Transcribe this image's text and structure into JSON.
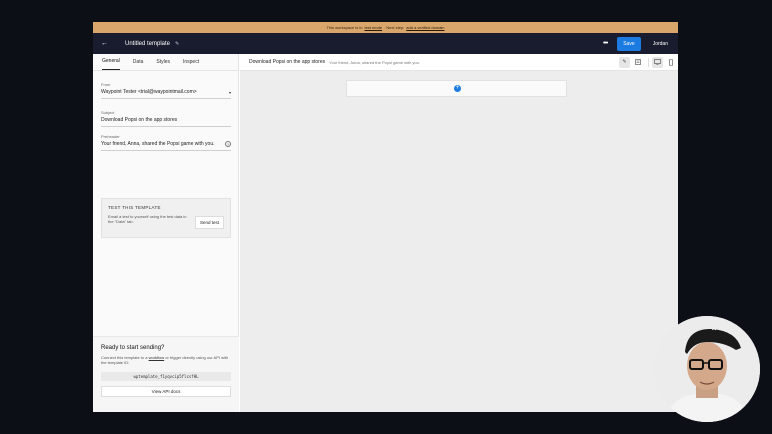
{
  "banner": {
    "prefix": "This workspace is in",
    "mode": "test mode",
    "middle": ". Next step:",
    "link": "add a verified domain"
  },
  "topbar": {
    "title": "Untitled template",
    "save_label": "Save",
    "user": "Jordan"
  },
  "tabs": [
    "General",
    "Data",
    "Styles",
    "Inspect"
  ],
  "fields": {
    "from": {
      "label": "From",
      "value": "Waypoint Tester <trial@waypointmail.com>"
    },
    "subject": {
      "label": "Subject",
      "value": "Download Popsi on the app stores"
    },
    "preheader": {
      "label": "Preheader",
      "value": "Your friend, Anna, shared the Popsi game with you."
    }
  },
  "test": {
    "title": "TEST THIS TEMPLATE",
    "description": "Email a test to yourself using the test data in the \"Data\" tab.",
    "button": "Send test"
  },
  "ready": {
    "heading": "Ready to start sending?",
    "text_1": "Connect this template to a",
    "workflow_link": "workflow",
    "text_2": "or trigger directly using our API with the template ID:",
    "template_id": "wptemplate_f1yqvcip5flcsfHL",
    "docs_button": "View API docs"
  },
  "editor": {
    "subject": "Download Popsi on the app stores",
    "preheader": "Your friend, Anna, shared the Popsi game with you."
  },
  "colors": {
    "accent": "#1b7be0",
    "topbar": "#191c2e",
    "banner": "#d8a56a"
  }
}
